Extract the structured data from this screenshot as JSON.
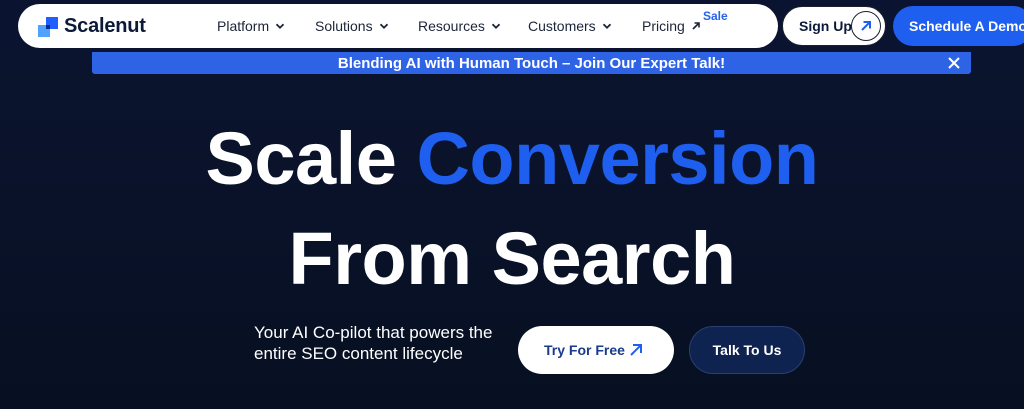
{
  "brand": {
    "name": "Scalenut"
  },
  "nav": {
    "items": [
      {
        "label": "Platform",
        "icon": "chevron-down-icon"
      },
      {
        "label": "Solutions",
        "icon": "chevron-down-icon"
      },
      {
        "label": "Resources",
        "icon": "chevron-down-icon"
      },
      {
        "label": "Customers",
        "icon": "chevron-down-icon"
      },
      {
        "label": "Pricing",
        "icon": "arrow-up-right-icon"
      }
    ],
    "sale_badge": "Sale",
    "signup_label": "Sign Up",
    "demo_label": "Schedule A Demo"
  },
  "banner": {
    "text": "Blending AI with Human Touch – Join Our Expert Talk!"
  },
  "hero": {
    "line1_plain": "Scale",
    "line1_accent": "Conversion",
    "line2": "From Search",
    "subtitle": "Your AI Co-pilot that powers the entire SEO content lifecycle",
    "cta_primary": "Try For Free",
    "cta_secondary": "Talk To Us"
  },
  "colors": {
    "accent": "#1f5ff0",
    "background": "#0a1430",
    "banner": "#2f63e6"
  }
}
